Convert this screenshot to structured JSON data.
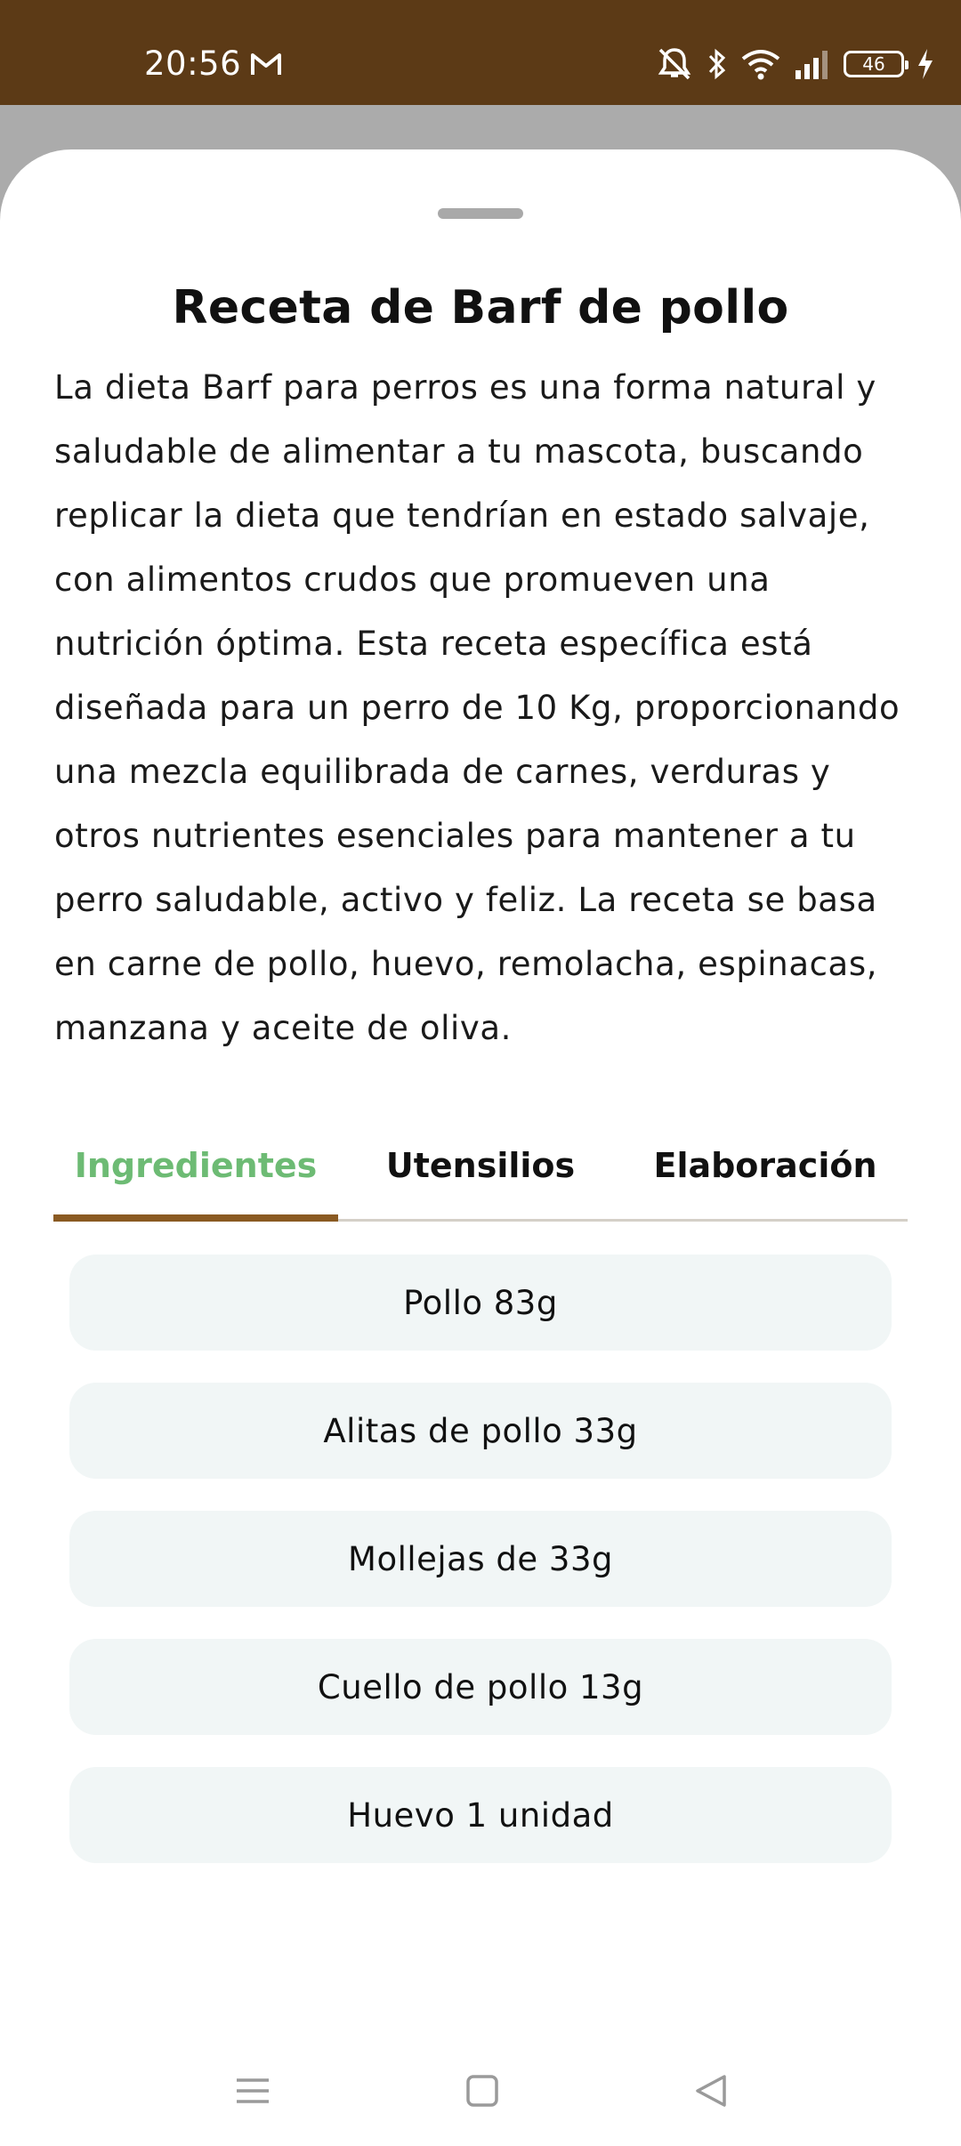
{
  "status_bar": {
    "time": "20:56",
    "battery": "46",
    "icons": [
      "gmail-icon",
      "mute-icon",
      "bluetooth-icon",
      "wifi-icon",
      "signal-icon",
      "battery-icon",
      "charging-icon"
    ]
  },
  "recipe": {
    "title": "Receta de Barf de pollo",
    "description": "La dieta Barf para perros es una forma natural y saludable de alimentar a tu mascota, buscando replicar la dieta que tendrían en estado salvaje, con alimentos crudos que promueven una nutrición óptima. Esta receta específica está diseñada para un perro de 10 Kg, proporcionando una mezcla equilibrada de carnes, verduras y otros nutrientes esenciales para mantener a tu perro saludable, activo y feliz. La receta se basa en carne de pollo, huevo, remolacha, espinacas, manzana y aceite de oliva."
  },
  "tabs": [
    {
      "label": "Ingredientes",
      "active": true
    },
    {
      "label": "Utensilios",
      "active": false
    },
    {
      "label": "Elaboración",
      "active": false
    }
  ],
  "ingredients": [
    "Pollo 83g",
    "Alitas de pollo 33g",
    "Mollejas de 33g",
    "Cuello de pollo 13g",
    "Huevo 1 unidad"
  ],
  "colors": {
    "status_bar": "#5c3a16",
    "accent_green": "#6dbb74",
    "tab_indicator": "#8a5a22",
    "ingredient_bg": "#f1f6f6"
  },
  "nav": [
    "menu-icon",
    "home-icon",
    "back-icon"
  ]
}
